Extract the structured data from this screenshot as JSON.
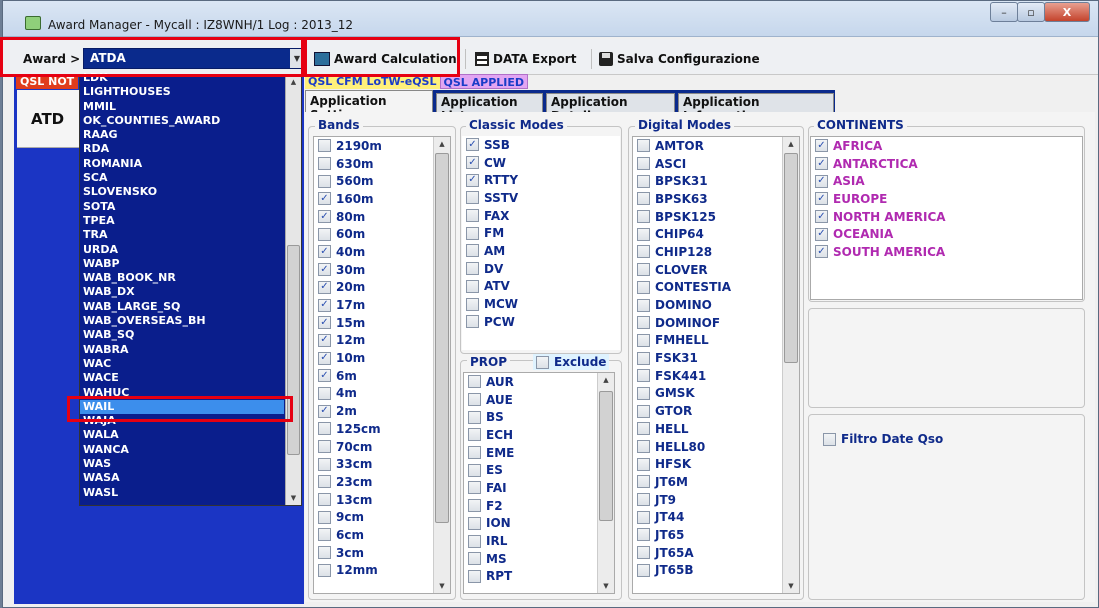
{
  "window": {
    "title": "Award Manager - Mycall : IZ8WNH/1   Log : 2013_12",
    "controls": {
      "minimize": "–",
      "maximize": "▫",
      "close": "X"
    }
  },
  "toolbar": {
    "award_label": "Award >",
    "award_value": "ATDA",
    "calc_label": "Award Calculation",
    "export_label": "DATA Export",
    "save_label": "Salva Configurazione"
  },
  "left": {
    "qsl_not_cfm": "QSL NOT",
    "award_code": "ATD"
  },
  "dropdown": {
    "items": [
      "LDK",
      "LIGHTHOUSES",
      "MMIL",
      "OK_COUNTIES_AWARD",
      "RAAG",
      "RDA",
      "ROMANIA",
      "SCA",
      "SLOVENSKO",
      "SOTA",
      "TPEA",
      "TRA",
      "URDA",
      "WABP",
      "WAB_BOOK_NR",
      "WAB_DX",
      "WAB_LARGE_SQ",
      "WAB_OVERSEAS_BH",
      "WAB_SQ",
      "WABRA",
      "WAC",
      "WACE",
      "WAHUC",
      "WAIL",
      "WAJA",
      "WALA",
      "WANCA",
      "WAS",
      "WASA",
      "WASL"
    ],
    "selected": "WAIL"
  },
  "chips": {
    "cfm": "QSL CFM LoTW-eQSL",
    "applied": "QSL APPLIED"
  },
  "tabs": [
    "Application Setting",
    "Application List",
    "Application Details",
    "Application Information"
  ],
  "bands": {
    "title": "Bands",
    "items": [
      {
        "label": "2190m",
        "checked": false
      },
      {
        "label": "630m",
        "checked": false
      },
      {
        "label": "560m",
        "checked": false
      },
      {
        "label": "160m",
        "checked": true
      },
      {
        "label": "80m",
        "checked": true
      },
      {
        "label": "60m",
        "checked": false
      },
      {
        "label": "40m",
        "checked": true
      },
      {
        "label": "30m",
        "checked": true
      },
      {
        "label": "20m",
        "checked": true
      },
      {
        "label": "17m",
        "checked": true
      },
      {
        "label": "15m",
        "checked": true
      },
      {
        "label": "12m",
        "checked": true
      },
      {
        "label": "10m",
        "checked": true
      },
      {
        "label": "6m",
        "checked": true
      },
      {
        "label": "4m",
        "checked": false
      },
      {
        "label": "2m",
        "checked": true
      },
      {
        "label": "125cm",
        "checked": false
      },
      {
        "label": "70cm",
        "checked": false
      },
      {
        "label": "33cm",
        "checked": false
      },
      {
        "label": "23cm",
        "checked": false
      },
      {
        "label": "13cm",
        "checked": false
      },
      {
        "label": "9cm",
        "checked": false
      },
      {
        "label": "6cm",
        "checked": false
      },
      {
        "label": "3cm",
        "checked": false
      },
      {
        "label": "12mm",
        "checked": false
      }
    ]
  },
  "classic": {
    "title": "Classic Modes",
    "items": [
      {
        "label": "SSB",
        "checked": true
      },
      {
        "label": "CW",
        "checked": true
      },
      {
        "label": "RTTY",
        "checked": true
      },
      {
        "label": "SSTV",
        "checked": false
      },
      {
        "label": "FAX",
        "checked": false
      },
      {
        "label": "FM",
        "checked": false
      },
      {
        "label": "AM",
        "checked": false
      },
      {
        "label": "DV",
        "checked": false
      },
      {
        "label": "ATV",
        "checked": false
      },
      {
        "label": "MCW",
        "checked": false
      },
      {
        "label": "PCW",
        "checked": false
      }
    ]
  },
  "prop": {
    "title": "PROP",
    "exclude_label": "Exclude",
    "items": [
      "AUR",
      "AUE",
      "BS",
      "ECH",
      "EME",
      "ES",
      "FAI",
      "F2",
      "ION",
      "IRL",
      "MS",
      "RPT"
    ]
  },
  "digital": {
    "title": "Digital Modes",
    "items": [
      "AMTOR",
      "ASCI",
      "BPSK31",
      "BPSK63",
      "BPSK125",
      "CHIP64",
      "CHIP128",
      "CLOVER",
      "CONTESTIA",
      "DOMINO",
      "DOMINOF",
      "FMHELL",
      "FSK31",
      "FSK441",
      "GMSK",
      "GTOR",
      "HELL",
      "HELL80",
      "HFSK",
      "JT6M",
      "JT9",
      "JT44",
      "JT65",
      "JT65A",
      "JT65B"
    ]
  },
  "continents": {
    "title": "CONTINENTS",
    "items": [
      "AFRICA",
      "ANTARCTICA",
      "ASIA",
      "EUROPE",
      "NORTH AMERICA",
      "OCEANIA",
      "SOUTH AMERICA"
    ]
  },
  "filtro": {
    "label": "Filtro Date Qso"
  }
}
